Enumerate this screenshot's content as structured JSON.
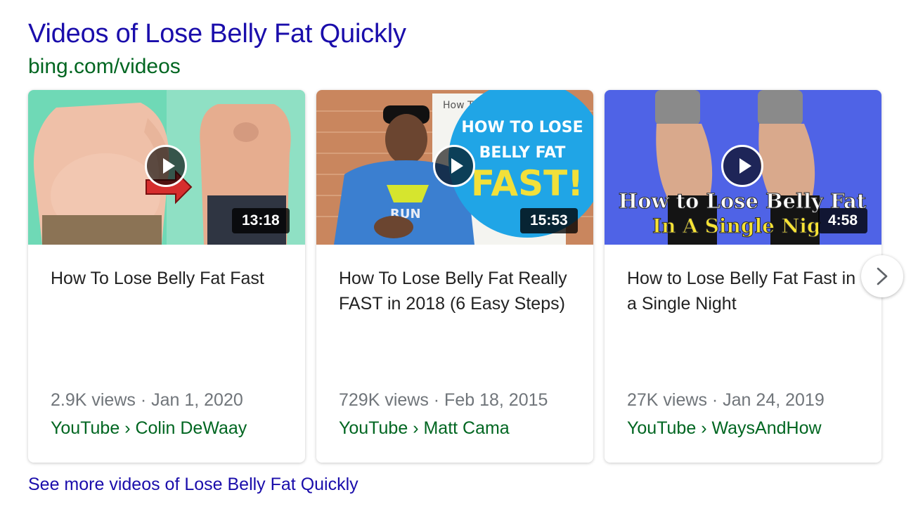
{
  "header": {
    "title": "Videos of Lose Belly Fat Quickly",
    "site": "bing.com/videos"
  },
  "videos": [
    {
      "duration": "13:18",
      "title": "How To Lose Belly Fat Fast",
      "meta": "2.9K views · Jan 1, 2020",
      "source": "YouTube › Colin DeWaay"
    },
    {
      "duration": "15:53",
      "title": "How To Lose Belly Fat Really FAST in 2018 (6 Easy Steps)",
      "meta": "729K views · Feb 18, 2015",
      "source": "YouTube › Matt Cama",
      "thumb_text": {
        "line1": "HOW TO LOSE",
        "line2": "BELLY FAT",
        "line3": "FAST!",
        "board": "How To",
        "shirt": "RUN"
      }
    },
    {
      "duration": "4:58",
      "title": "How to Lose Belly Fat Fast in a Single Night",
      "meta": "27K views · Jan 24, 2019",
      "source": "YouTube › WaysAndHow",
      "thumb_text": {
        "line1": "How to Lose Belly Fat",
        "line2": "In A Single Nig"
      }
    }
  ],
  "footer": {
    "more_link": "See more videos of Lose Belly Fat Quickly"
  },
  "icons": {
    "play": "play-icon",
    "next": "chevron-right-icon"
  },
  "colors": {
    "link": "#1a0dab",
    "url_green": "#006621",
    "meta_gray": "#70757a"
  }
}
